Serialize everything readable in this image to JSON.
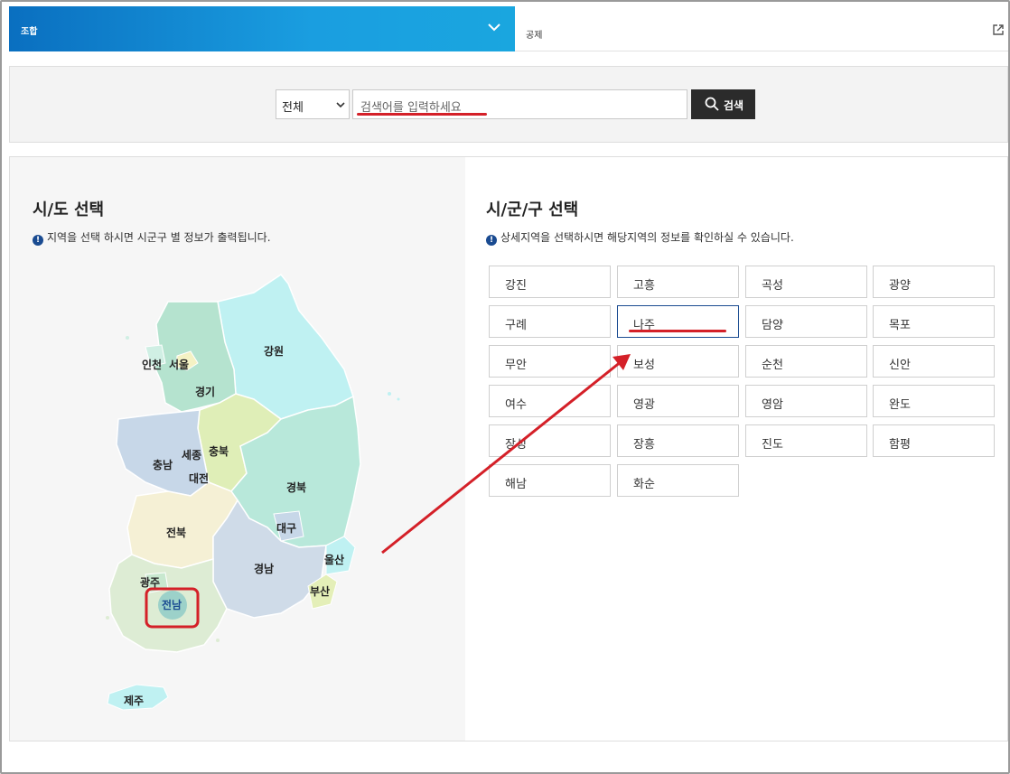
{
  "tabs": {
    "active": "조합",
    "second": "공제"
  },
  "search": {
    "select_value": "전체",
    "placeholder": "검색어를 입력하세요",
    "button_label": "검색"
  },
  "left": {
    "title": "시/도 선택",
    "note": "지역을 선택 하시면 시군구 별 정보가 출력됩니다."
  },
  "right": {
    "title": "시/군/구 선택",
    "note": "상세지역을 선택하시면 해당지역의 정보를 확인하실 수 있습니다."
  },
  "regions": [
    "인천",
    "서울",
    "강원",
    "경기",
    "세종",
    "충북",
    "충남",
    "대전",
    "경북",
    "전북",
    "대구",
    "울산",
    "경남",
    "광주",
    "부산",
    "전남",
    "제주"
  ],
  "selected_region": "전남",
  "districts": [
    "강진",
    "고흥",
    "곡성",
    "광양",
    "구례",
    "나주",
    "담양",
    "목포",
    "무안",
    "보성",
    "순천",
    "신안",
    "여수",
    "영광",
    "영암",
    "완도",
    "장성",
    "장흥",
    "진도",
    "함평",
    "해남",
    "화순"
  ],
  "selected_district": "나주",
  "colors": {
    "accent_red": "#d42028",
    "tab_blue": "#1a9ee0",
    "button_dark": "#2b2b2b"
  }
}
